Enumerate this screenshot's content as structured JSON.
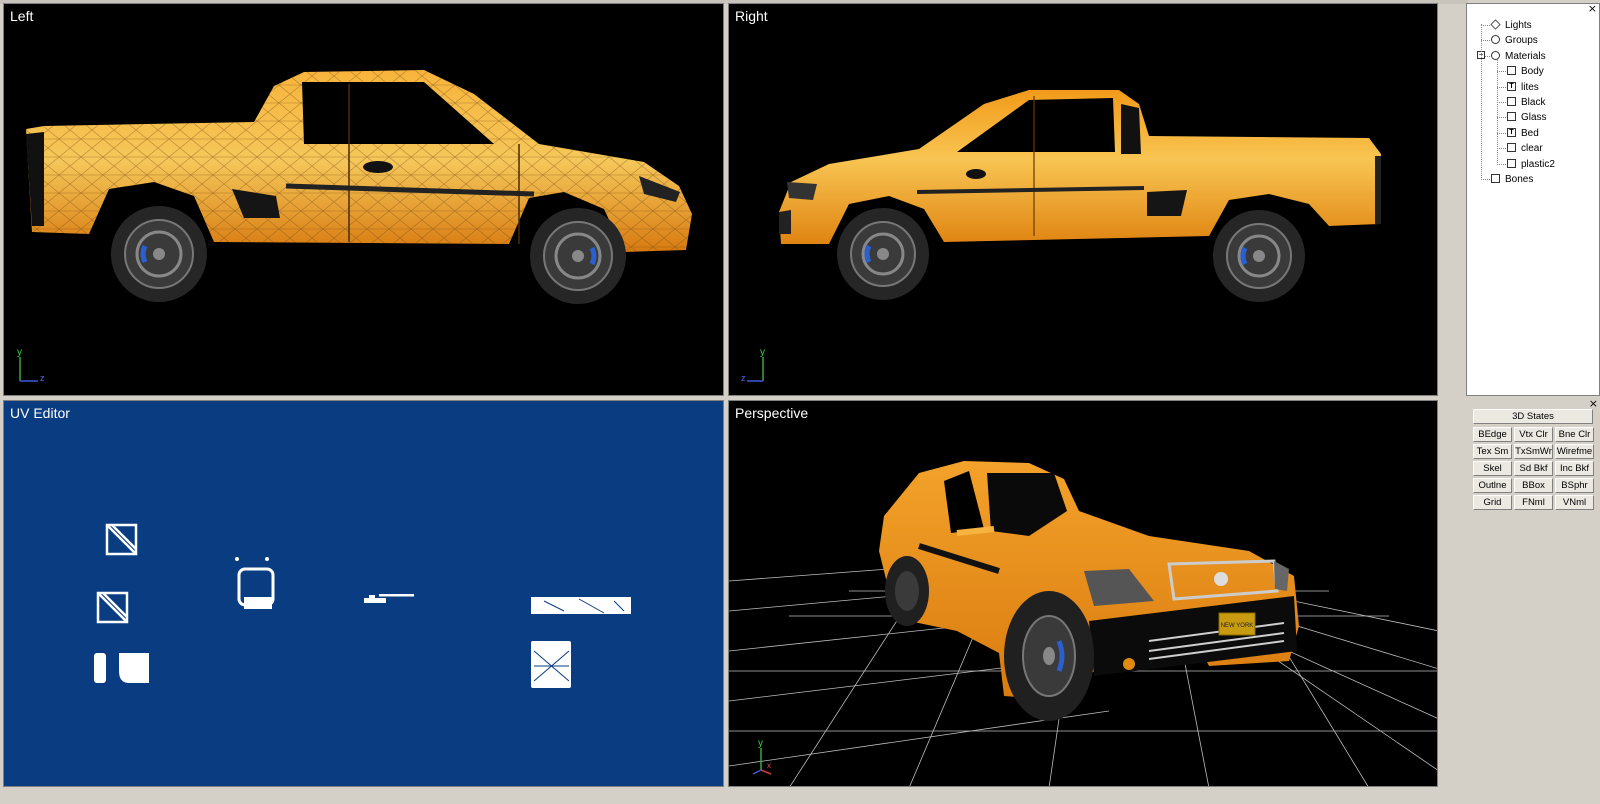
{
  "viewports": {
    "left": {
      "title": "Left",
      "axis_v": "y",
      "axis_h": "z"
    },
    "right": {
      "title": "Right",
      "axis_v": "y",
      "axis_h": "z"
    },
    "uv": {
      "title": "UV Editor"
    },
    "perspective": {
      "title": "Perspective",
      "axis_v": "y",
      "axis_h": "x"
    }
  },
  "scene_tree": {
    "close": "×",
    "items": [
      {
        "label": "Lights",
        "icon": "light-icon"
      },
      {
        "label": "Groups",
        "icon": "group-icon"
      },
      {
        "label": "Materials",
        "icon": "material-icon",
        "expander": "−"
      },
      {
        "label": "Body",
        "icon": "material-swatch-icon"
      },
      {
        "label": "lites",
        "icon": "texture-material-icon",
        "glyph": "T"
      },
      {
        "label": "Black",
        "icon": "material-swatch-icon"
      },
      {
        "label": "Glass",
        "icon": "material-swatch-icon"
      },
      {
        "label": "Bed",
        "icon": "texture-material-icon",
        "glyph": "T"
      },
      {
        "label": "clear",
        "icon": "material-swatch-icon"
      },
      {
        "label": "plastic2",
        "icon": "material-swatch-icon"
      },
      {
        "label": "Bones",
        "icon": "bone-icon"
      }
    ]
  },
  "states_panel": {
    "close": "×",
    "header": "3D States",
    "buttons": [
      [
        "BEdge",
        "Vtx Clr",
        "Bne Clr"
      ],
      [
        "Tex Sm",
        "TxSmWr",
        "Wirefme"
      ],
      [
        "Skel",
        "Sd Bkf",
        "Inc Bkf"
      ],
      [
        "Outlne",
        "BBox",
        "BSphr"
      ],
      [
        "Grid",
        "FNml",
        "VNml"
      ]
    ]
  },
  "license_plate_text": "NEW YORK",
  "colors": {
    "viewport_bg": "#000000",
    "uv_bg": "#0a3c82",
    "car_body": "#f39a1e",
    "panel_bg": "#d4d0c8",
    "rim_accent": "#2a5fd0"
  }
}
